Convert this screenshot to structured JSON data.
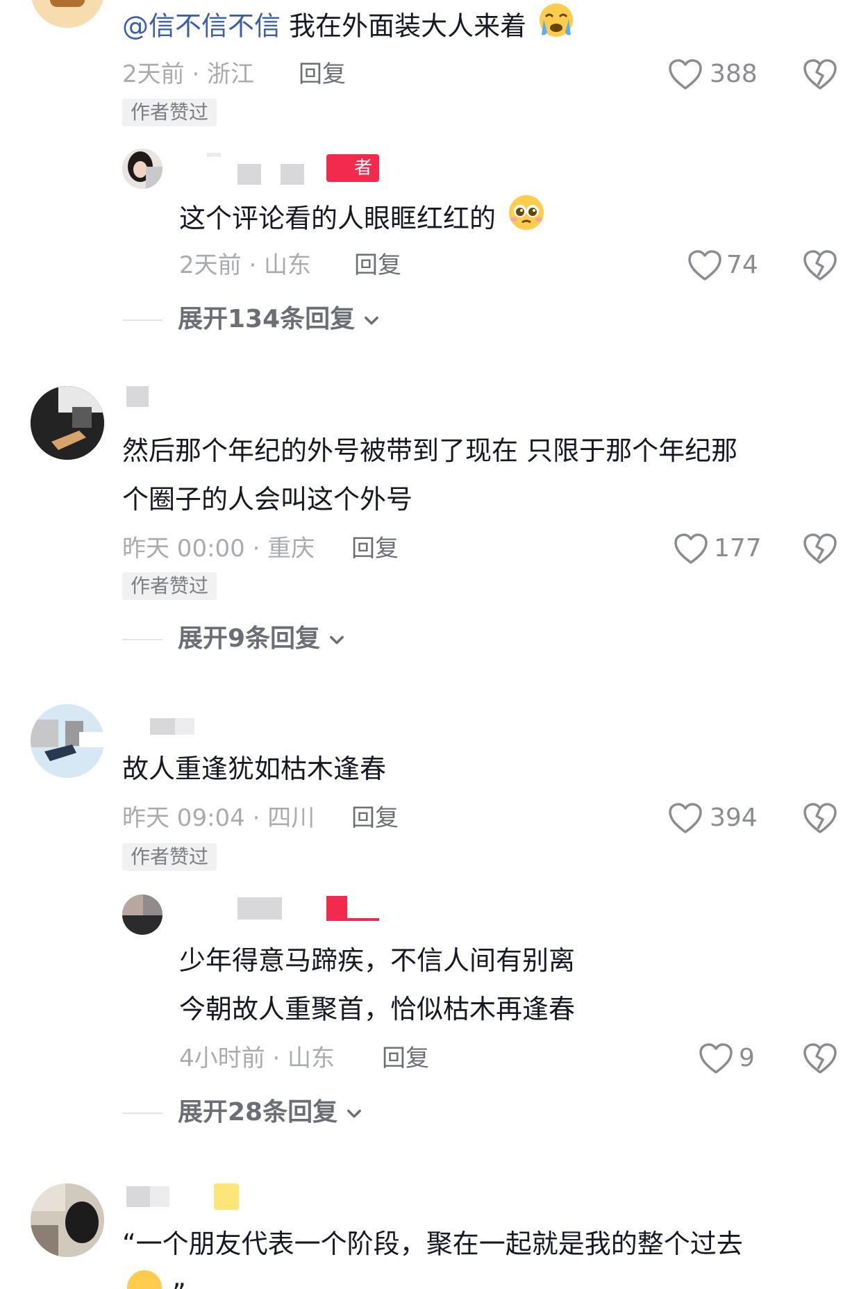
{
  "comments": [
    {
      "mention": "@信不信不信",
      "text": "我在外面装大人来着",
      "emoji": "crying-face-icon",
      "meta": "2天前 · 浙江",
      "reply": "回复",
      "likes": "388",
      "badge": "作者赞过",
      "sub_reply": {
        "tag": "者",
        "text": "这个评论看的人眼眶红红的",
        "emoji": "pleading-face-icon",
        "meta": "2天前 · 山东",
        "reply": "回复",
        "likes": "74"
      },
      "expand": "展开134条回复"
    },
    {
      "text_line1": "然后那个年纪的外号被带到了现在 只限于那个年纪那",
      "text_line2": "个圈子的人会叫这个外号",
      "meta": "昨天 00:00 · 重庆",
      "reply": "回复",
      "likes": "177",
      "badge": "作者赞过",
      "expand": "展开9条回复"
    },
    {
      "text": "故人重逢犹如枯木逢春",
      "meta": "昨天 09:04 · 四川",
      "reply": "回复",
      "likes": "394",
      "badge": "作者赞过",
      "sub_reply": {
        "text_line1": "少年得意马蹄疾，不信人间有别离",
        "text_line2": "今朝故人重聚首，恰似枯木再逢春",
        "meta": "4小时前 · 山东",
        "reply": "回复",
        "likes": "9"
      },
      "expand": "展开28条回复"
    },
    {
      "text_line1": "“一个朋友代表一个阶段，聚在一起就是我的整个过去",
      "text_line2": "”"
    }
  ]
}
